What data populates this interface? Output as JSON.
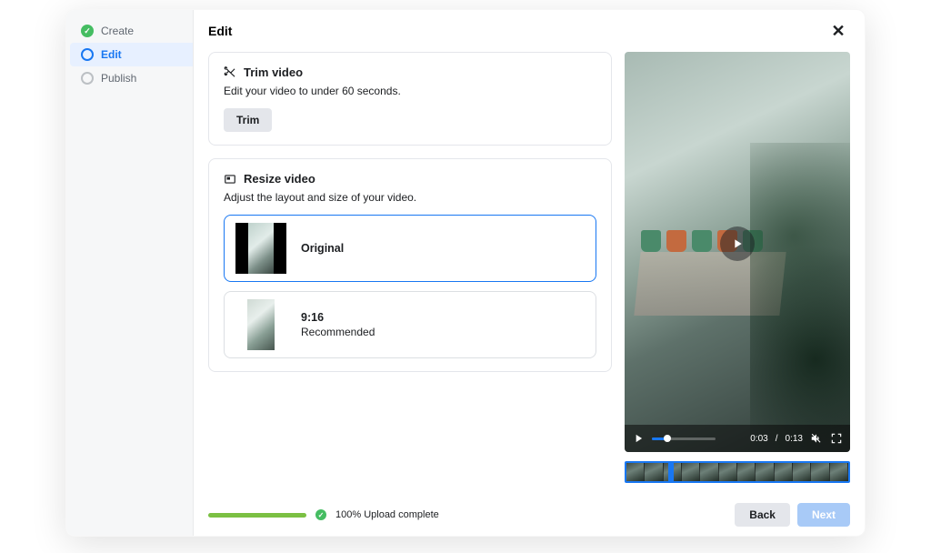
{
  "header": {
    "title": "Edit"
  },
  "sidebar": {
    "items": [
      {
        "label": "Create"
      },
      {
        "label": "Edit"
      },
      {
        "label": "Publish"
      }
    ]
  },
  "trim_card": {
    "title": "Trim video",
    "desc": "Edit your video to under 60 seconds.",
    "button": "Trim"
  },
  "resize_card": {
    "title": "Resize video",
    "desc": "Adjust the layout and size of your video.",
    "options": [
      {
        "title": "Original",
        "sub": ""
      },
      {
        "title": "9:16",
        "sub": "Recommended"
      }
    ]
  },
  "player": {
    "current": "0:03",
    "duration": "0:13",
    "sep": " / "
  },
  "upload": {
    "text": "100% Upload complete"
  },
  "footer": {
    "back": "Back",
    "next": "Next"
  }
}
